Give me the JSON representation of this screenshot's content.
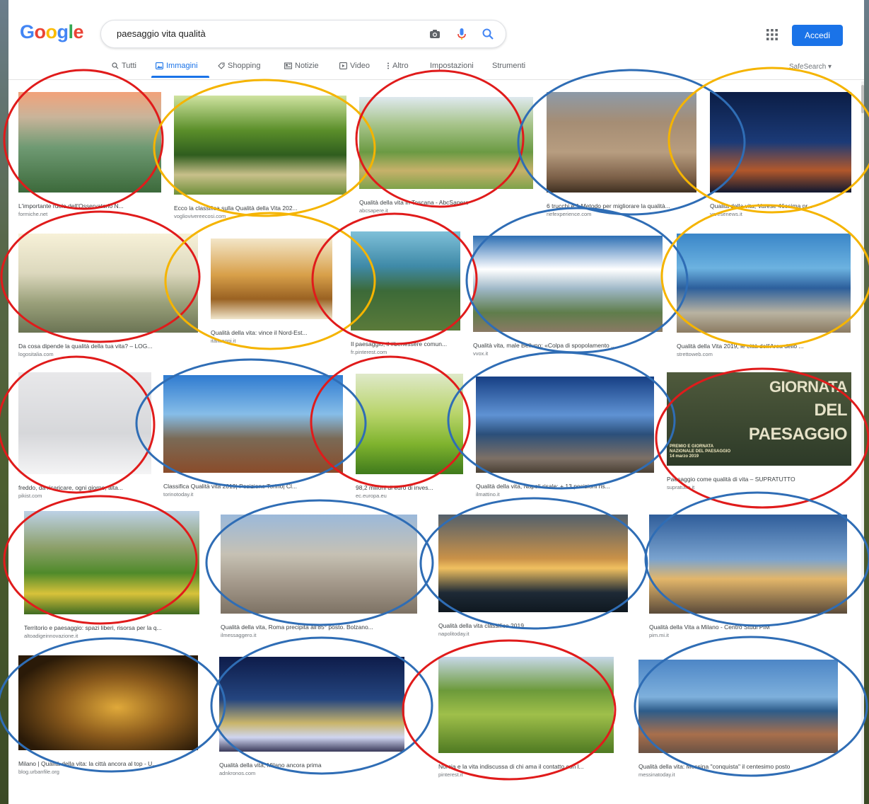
{
  "search": {
    "logo": "Google",
    "query": "paesaggio vita qualità",
    "signin_label": "Accedi"
  },
  "tabs": [
    {
      "label": "Tutti",
      "icon": "search-icon"
    },
    {
      "label": "Immagini",
      "icon": "image-icon",
      "active": true
    },
    {
      "label": "Shopping",
      "icon": "tag-icon"
    },
    {
      "label": "Notizie",
      "icon": "newspaper-icon"
    },
    {
      "label": "Video",
      "icon": "play-icon"
    },
    {
      "label": "Altro",
      "icon": "more-vert-icon"
    },
    {
      "label": "Impostazioni"
    },
    {
      "label": "Strumenti"
    }
  ],
  "safesearch_label": "SafeSearch ▾",
  "poster_lines": [
    "GIORNATA",
    "DEL",
    "PAESAGGIO"
  ],
  "poster_sub": [
    "PREMIO E GIORNATA",
    "NAZIONALE DEL PAESAGGIO",
    "14 marzo 2019"
  ],
  "results": [
    {
      "caption": "L'importante ruolo dell'Osservatorio N...",
      "site": "formiche.net",
      "ring": "red"
    },
    {
      "caption": "Ecco la classifica sulla Qualità della Vita 202...",
      "site": "vogliovivereecosi.com",
      "ring": "yellow"
    },
    {
      "caption": "Qualità della vita in Toscana - AbcSapere",
      "site": "abcsapere.it",
      "ring": "red"
    },
    {
      "caption": "6 trucchi e 1 Metodo per migliorare la qualità...",
      "site": "riefexperience.com",
      "ring": "blue"
    },
    {
      "caption": "Qualità della vita, Varese 46esima pr...",
      "site": "varesenews.it",
      "ring": "yellow"
    },
    {
      "caption": "Da cosa dipende la qualità della tua vita? – LOG...",
      "site": "logositalia.com",
      "ring": "red"
    },
    {
      "caption": "Qualità della vita: vince il Nord-Est...",
      "site": "italiaoggi.it",
      "ring": "yellow"
    },
    {
      "caption": "Il paesaggio, il #benessere comun...",
      "site": "fr.pinterest.com",
      "ring": "red"
    },
    {
      "caption": "Qualità vita, male Belluno: «Colpa di spopolamento ...",
      "site": "vvox.it",
      "ring": "blue"
    },
    {
      "caption": "Qualità della Vita 2019, le città dell'Area dello ...",
      "site": "strettoweb.com",
      "ring": "yellow"
    },
    {
      "caption": "freddo, da ricaricare, ogni giorno, alta...",
      "site": "pikist.com",
      "ring": "red"
    },
    {
      "caption": "Classifica Qualità vita 2019| Posizione Torino| Cl...",
      "site": "torinotoday.it",
      "ring": "blue"
    },
    {
      "caption": "98,2 milioni di euro di inves...",
      "site": "ec.europa.eu",
      "ring": "red"
    },
    {
      "caption": "Qualità della vita, Napoli risale: + 13 posizioni ris...",
      "site": "ilmattino.it",
      "ring": "blue"
    },
    {
      "caption": "Paesaggio come qualità di vita – SUPRATUTTO",
      "site": "supratutto.it",
      "ring": "red"
    },
    {
      "caption": "Territorio e paesaggio: spazi liberi, risorsa per la q...",
      "site": "altoadigeinnovazione.it",
      "ring": "red"
    },
    {
      "caption": "Qualità della vita, Roma precipita all'85° posto. Bolzano...",
      "site": "ilmessaggero.it",
      "ring": "blue"
    },
    {
      "caption": "Qualità della vita classifica 2019",
      "site": "napolitoday.it",
      "ring": "blue"
    },
    {
      "caption": "Qualità della Vita a Milano - Centro Studi PIM",
      "site": "pim.mi.it",
      "ring": "blue"
    },
    {
      "caption": "Milano | Qualità della vita: la città ancora al top - U...",
      "site": "blog.urbanfile.org",
      "ring": "blue"
    },
    {
      "caption": "Qualità della vita, Milano ancora prima",
      "site": "adnkronos.com",
      "ring": "blue"
    },
    {
      "caption": "Norcia e la vita indiscussa di chi ama il contatto con l...",
      "site": "pinterest.it",
      "ring": "red"
    },
    {
      "caption": "Qualità della vita: Messina \"conquista\" il centesimo posto",
      "site": "messinatoday.it",
      "ring": "blue"
    }
  ],
  "colors": {
    "ring_red": "#e01b1b",
    "ring_yellow": "#f5b400",
    "ring_blue": "#2f6db5",
    "accent": "#1a73e8"
  }
}
